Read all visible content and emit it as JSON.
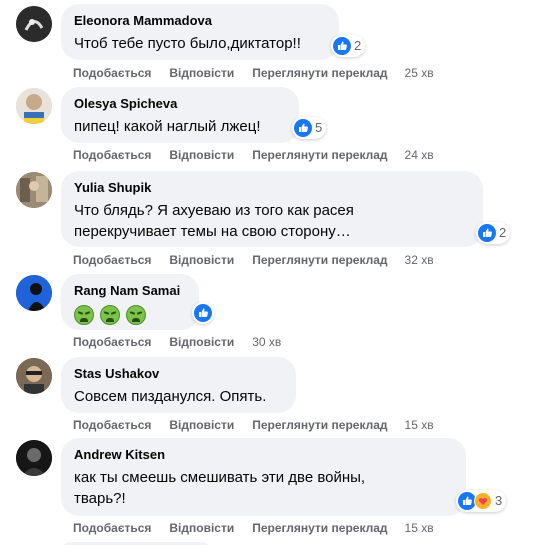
{
  "colors": {
    "bubble_bg": "#f0f2f5",
    "action_text": "#65676b",
    "like_blue": "#1877f2"
  },
  "comments": [
    {
      "author": "Eleonora Mammadova",
      "text": "Чтоб тебе пусто было,диктатор!!",
      "reactions": {
        "icons": [
          "like-icon"
        ],
        "count": "2"
      },
      "actions": {
        "like": "Подобається",
        "reply": "Відповісти",
        "translate": "Переглянути переклад",
        "time": "25 хв"
      }
    },
    {
      "author": "Olesya Spicheva",
      "text": "пипец! какой наглый лжец!",
      "reactions": {
        "icons": [
          "like-icon"
        ],
        "count": "5"
      },
      "actions": {
        "like": "Подобається",
        "reply": "Відповісти",
        "translate": "Переглянути переклад",
        "time": "24 хв"
      }
    },
    {
      "author": "Yulia Shupik",
      "text": "Что блядь? Я ахуеваю из того как расея\nперекручивает темы на свою сторону…",
      "reactions": {
        "icons": [
          "like-icon"
        ],
        "count": "2"
      },
      "actions": {
        "like": "Подобається",
        "reply": "Відповісти",
        "translate": "Переглянути переклад",
        "time": "32 хв"
      }
    },
    {
      "author": "Rang Nam Samai",
      "text": "",
      "emojis": [
        "nauseated-face-emoji",
        "nauseated-face-emoji",
        "nauseated-face-emoji"
      ],
      "reactions": {
        "icons": [
          "like-icon"
        ],
        "count": ""
      },
      "actions": {
        "like": "Подобається",
        "reply": "Відповісти",
        "time": "30 хв"
      }
    },
    {
      "author": "Stas Ushakov",
      "text": "Совсем пизданулся. Опять.",
      "actions": {
        "like": "Подобається",
        "reply": "Відповісти",
        "translate": "Переглянути переклад",
        "time": "15 хв"
      }
    },
    {
      "author": "Andrew Kitsen",
      "text": "как ты смеешь смешивать эти две войны,\nтварь?!",
      "reactions": {
        "icons": [
          "like-icon",
          "care-icon"
        ],
        "count": "3"
      },
      "actions": {
        "like": "Подобається",
        "reply": "Відповісти",
        "translate": "Переглянути переклад",
        "time": "15 хв"
      }
    }
  ]
}
